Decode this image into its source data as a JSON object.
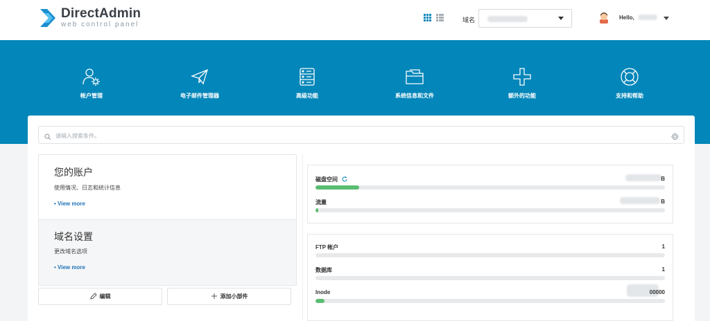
{
  "brand": {
    "title": "DirectAdmin",
    "subtitle": "web control panel",
    "colors": {
      "banner": "#0386b9",
      "accent": "#1f72b8",
      "progress": "#5bbd72"
    }
  },
  "header": {
    "domain_label": "域名",
    "domain_value": "",
    "user_greeting": "Hello,"
  },
  "nav": [
    {
      "label": "帐户管理",
      "icon": "account-gear-icon"
    },
    {
      "label": "电子邮件管理器",
      "icon": "paper-plane-icon"
    },
    {
      "label": "高级功能",
      "icon": "server-icon"
    },
    {
      "label": "系统信息和文件",
      "icon": "folder-icon"
    },
    {
      "label": "额外的功能",
      "icon": "plus-icon"
    },
    {
      "label": "支持和帮助",
      "icon": "lifebuoy-icon"
    }
  ],
  "search": {
    "placeholder": "请输入搜索条件。"
  },
  "sections": [
    {
      "title": "您的账户",
      "subtitle": "使用情况、日志和统计信息",
      "link": "• View more"
    },
    {
      "title": "域名设置",
      "subtitle": "更改域名选项",
      "link": "• View more"
    }
  ],
  "buttons": {
    "edit": "编辑",
    "add_widget": "添加小部件"
  },
  "usage": [
    {
      "label": "磁盘空间",
      "value": "B",
      "progress": 0.125
    },
    {
      "label": "流量",
      "value": "B",
      "progress": 0.008
    }
  ],
  "counts": [
    {
      "label": "FTP 帐户",
      "value": "1",
      "progress": 0
    },
    {
      "label": "数据库",
      "value": "1",
      "progress": 0
    },
    {
      "label": "Inode",
      "value": "00000",
      "progress": 0.025
    }
  ]
}
